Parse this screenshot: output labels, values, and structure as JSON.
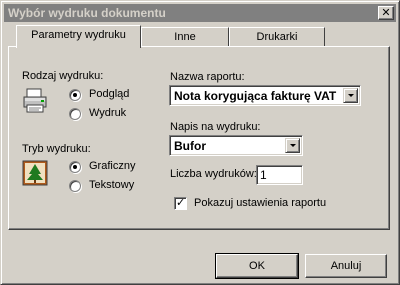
{
  "window": {
    "title": "Wybór wydruku dokumentu",
    "close_symbol": "✕"
  },
  "tabs": [
    {
      "label": "Parametry wydruku",
      "underline": "",
      "rest": "",
      "active": true
    },
    {
      "label": "Inne",
      "underline": "",
      "rest": ""
    },
    {
      "label": "Drukarki",
      "underline": "",
      "rest": ""
    }
  ],
  "print_type": {
    "label": "Rodzaj wydruku:",
    "icon": "printer-icon",
    "options": [
      {
        "label": "Podgląd",
        "checked": true
      },
      {
        "label": "Wydruk",
        "checked": false
      }
    ]
  },
  "print_mode": {
    "label": "Tryb wydruku:",
    "icon": "tree-picture-icon",
    "options": [
      {
        "label": "Graficzny",
        "checked": true
      },
      {
        "label": "Tekstowy",
        "checked": false
      }
    ]
  },
  "report_name": {
    "label": "Nazwa raportu:",
    "value": "Nota korygująca fakturę VAT"
  },
  "print_caption": {
    "label": "Napis na wydruku:",
    "value": "Bufor"
  },
  "copies": {
    "label": "Liczba wydruków:",
    "value": "1"
  },
  "show_settings": {
    "label": "Pokazuj ustawienia raportu",
    "checked": true,
    "mark": "✓"
  },
  "buttons": {
    "ok": "OK",
    "cancel": "Anuluj"
  }
}
